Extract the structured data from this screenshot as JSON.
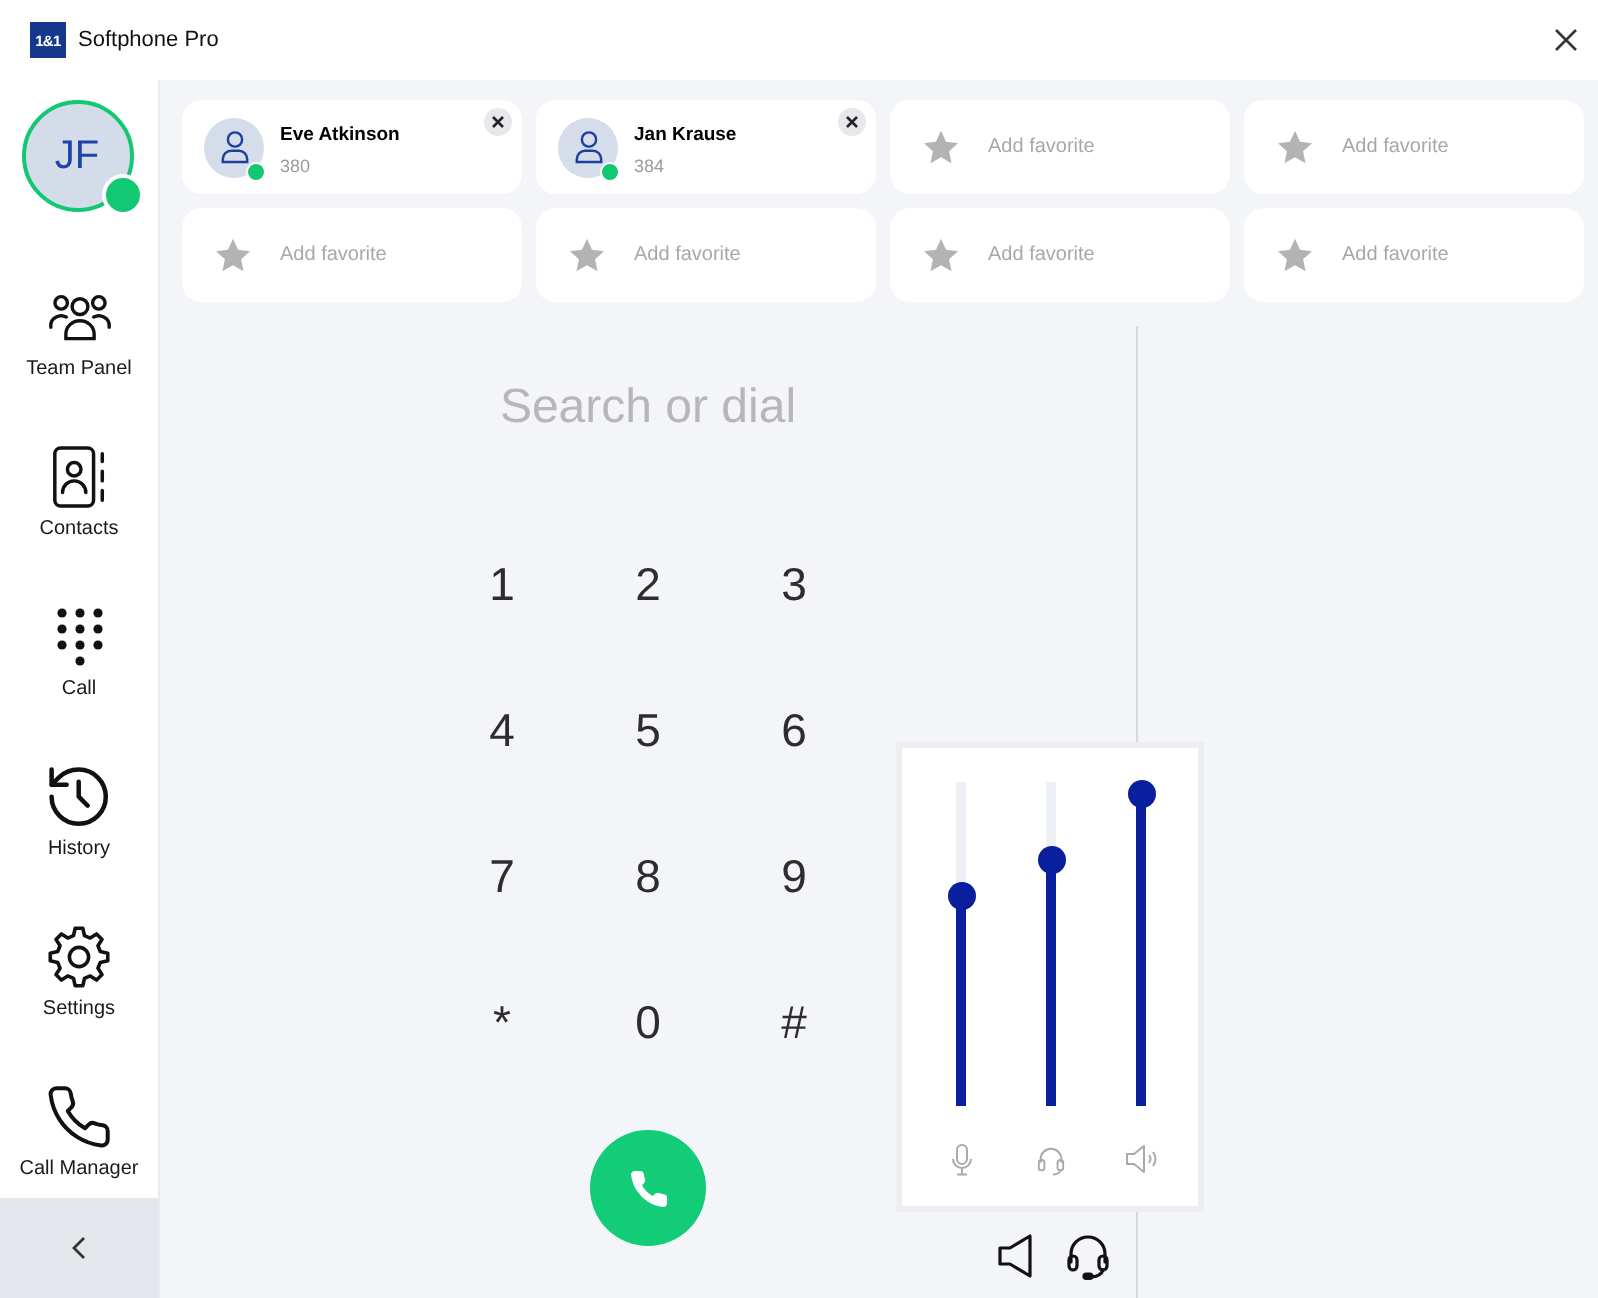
{
  "window": {
    "logo": "1&1",
    "title": "Softphone Pro"
  },
  "profile": {
    "initials": "JF",
    "color": "#13c872"
  },
  "sidebar": {
    "items": [
      {
        "label": "Team Panel"
      },
      {
        "label": "Contacts"
      },
      {
        "label": "Call"
      },
      {
        "label": "History"
      },
      {
        "label": "Settings"
      },
      {
        "label": "Call Manager"
      }
    ]
  },
  "favorites": [
    {
      "kind": "contact",
      "name": "Eve Atkinson",
      "number": "380",
      "color": "#13c872"
    },
    {
      "kind": "contact",
      "name": "Jan Krause",
      "number": "384",
      "color": "#13c872"
    },
    {
      "kind": "empty",
      "label": "Add favorite"
    },
    {
      "kind": "empty",
      "label": "Add favorite"
    },
    {
      "kind": "empty",
      "label": "Add favorite"
    },
    {
      "kind": "empty",
      "label": "Add favorite"
    },
    {
      "kind": "empty",
      "label": "Add favorite"
    },
    {
      "kind": "empty",
      "label": "Add favorite"
    }
  ],
  "dialer": {
    "placeholder": "Search or dial",
    "keys": [
      "1",
      "2",
      "3",
      "4",
      "5",
      "6",
      "7",
      "8",
      "9",
      "*",
      "0",
      "#"
    ]
  },
  "volume": {
    "sliders": [
      {
        "level": 0.65
      },
      {
        "level": 0.76
      },
      {
        "level": 0.96
      }
    ]
  }
}
